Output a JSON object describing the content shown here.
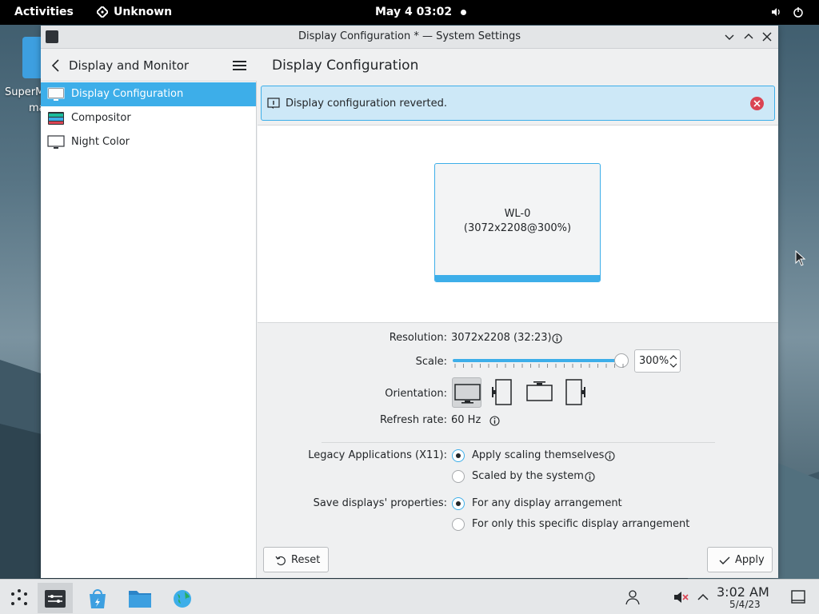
{
  "topbar": {
    "activities": "Activities",
    "app_name": "Unknown",
    "date": "May 4  03:02"
  },
  "desktop": {
    "icon_label_1": "SuperM",
    "icon_label_2": "ma"
  },
  "window": {
    "title": "Display Configuration * — System Settings"
  },
  "sidebar": {
    "header": "Display and Monitor",
    "items": [
      {
        "label": "Display Configuration",
        "active": true
      },
      {
        "label": "Compositor",
        "active": false
      },
      {
        "label": "Night Color",
        "active": false
      }
    ]
  },
  "main": {
    "title": "Display Configuration",
    "banner": "Display configuration reverted.",
    "monitor": {
      "name": "WL-0",
      "resolution": "(3072x2208@300%)"
    },
    "form": {
      "resolution_label": "Resolution:",
      "resolution_value": "3072x2208 (32:23)",
      "scale_label": "Scale:",
      "scale_value": "300%",
      "scale_fraction": 1.0,
      "orientation_label": "Orientation:",
      "refresh_label": "Refresh rate:",
      "refresh_value": "60 Hz",
      "legacy_label": "Legacy Applications (X11):",
      "legacy_options": [
        "Apply scaling themselves",
        "Scaled by the system"
      ],
      "legacy_selected": 0,
      "save_label": "Save displays' properties:",
      "save_options": [
        "For any display arrangement",
        "For only this specific display arrangement"
      ],
      "save_selected": 0
    },
    "buttons": {
      "reset": "Reset",
      "apply": "Apply"
    }
  },
  "taskbar": {
    "time": "3:02 AM",
    "date": "5/4/23"
  },
  "colors": {
    "accent": "#3daee9",
    "close_red": "#da4453",
    "topbar": "#000000"
  }
}
